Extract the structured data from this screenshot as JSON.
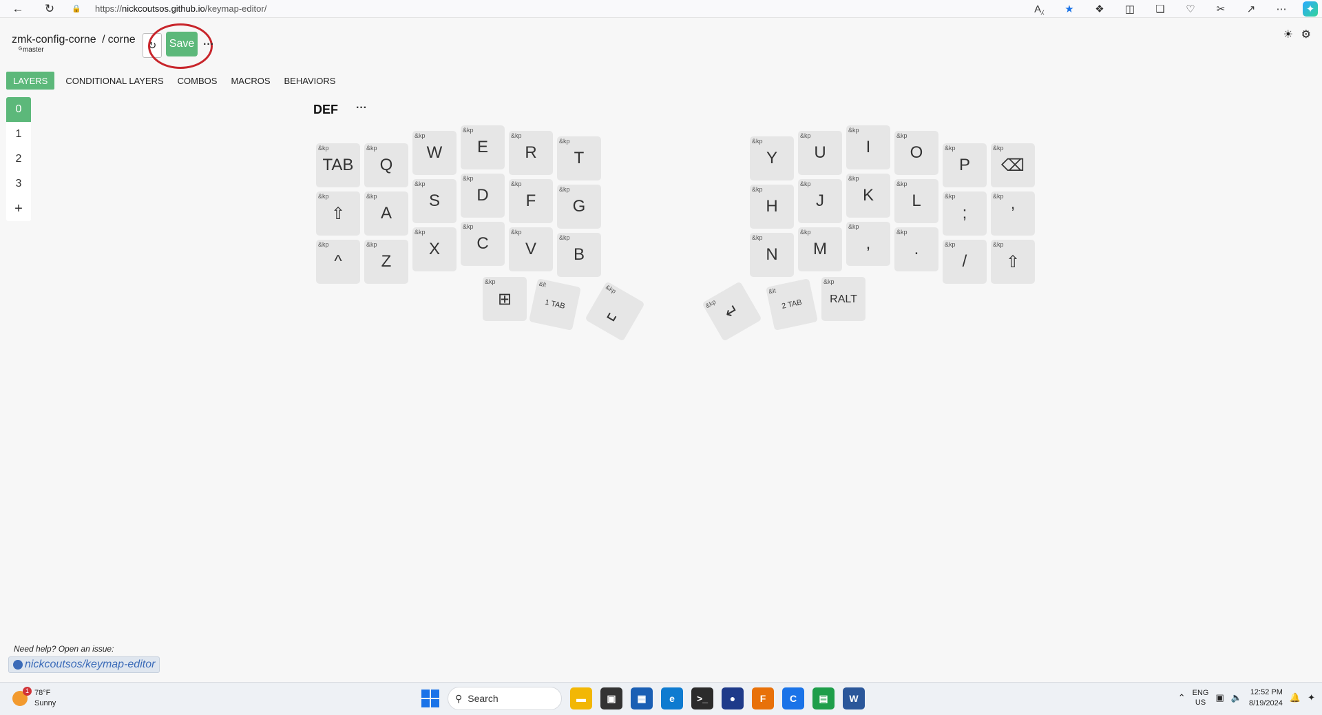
{
  "browser": {
    "url_prefix": "https://",
    "url_host": "nickcoutsos.github.io",
    "url_path": "/keymap-editor/",
    "icons": [
      "read-aloud-icon",
      "favorite-star-icon",
      "extensions-icon",
      "split-screen-icon",
      "collections-icon",
      "browser-essentials-icon",
      "screenshot-icon",
      "share-icon",
      "more-icon",
      "copilot-icon"
    ]
  },
  "header": {
    "repo": "zmk-config-corne",
    "separator": "/",
    "keyboard": "corne",
    "branch": "master",
    "save_label": "Save",
    "more_label": "···"
  },
  "tabs": [
    {
      "label": "LAYERS",
      "active": true
    },
    {
      "label": "CONDITIONAL LAYERS",
      "active": false
    },
    {
      "label": "COMBOS",
      "active": false
    },
    {
      "label": "MACROS",
      "active": false
    },
    {
      "label": "BEHAVIORS",
      "active": false
    }
  ],
  "layers": {
    "items": [
      "0",
      "1",
      "2",
      "3"
    ],
    "add_label": "+",
    "selected": "0"
  },
  "layer_view": {
    "name": "DEF",
    "more_label": "···"
  },
  "keys": [
    {
      "bind": "&kp",
      "param": "TAB"
    },
    {
      "bind": "&kp",
      "param": "Q"
    },
    {
      "bind": "&kp",
      "param": "W"
    },
    {
      "bind": "&kp",
      "param": "E"
    },
    {
      "bind": "&kp",
      "param": "R"
    },
    {
      "bind": "&kp",
      "param": "T"
    },
    {
      "bind": "&kp",
      "param": "Y"
    },
    {
      "bind": "&kp",
      "param": "U"
    },
    {
      "bind": "&kp",
      "param": "I"
    },
    {
      "bind": "&kp",
      "param": "O"
    },
    {
      "bind": "&kp",
      "param": "P"
    },
    {
      "bind": "&kp",
      "param": "⌫"
    },
    {
      "bind": "&kp",
      "param": "⇧"
    },
    {
      "bind": "&kp",
      "param": "A"
    },
    {
      "bind": "&kp",
      "param": "S"
    },
    {
      "bind": "&kp",
      "param": "D"
    },
    {
      "bind": "&kp",
      "param": "F"
    },
    {
      "bind": "&kp",
      "param": "G"
    },
    {
      "bind": "&kp",
      "param": "H"
    },
    {
      "bind": "&kp",
      "param": "J"
    },
    {
      "bind": "&kp",
      "param": "K"
    },
    {
      "bind": "&kp",
      "param": "L"
    },
    {
      "bind": "&kp",
      "param": ";"
    },
    {
      "bind": "&kp",
      "param": "’"
    },
    {
      "bind": "&kp",
      "param": "^"
    },
    {
      "bind": "&kp",
      "param": "Z"
    },
    {
      "bind": "&kp",
      "param": "X"
    },
    {
      "bind": "&kp",
      "param": "C"
    },
    {
      "bind": "&kp",
      "param": "V"
    },
    {
      "bind": "&kp",
      "param": "B"
    },
    {
      "bind": "&kp",
      "param": "N"
    },
    {
      "bind": "&kp",
      "param": "M"
    },
    {
      "bind": "&kp",
      "param": ","
    },
    {
      "bind": "&kp",
      "param": "."
    },
    {
      "bind": "&kp",
      "param": "/"
    },
    {
      "bind": "&kp",
      "param": "⇧"
    },
    {
      "bind": "&kp",
      "param": "⊞"
    },
    {
      "bind": "&lt",
      "param": "1 TAB"
    },
    {
      "bind": "&kp",
      "param": "␣"
    },
    {
      "bind": "&kp",
      "param": "↵"
    },
    {
      "bind": "&lt",
      "param": "2 TAB"
    },
    {
      "bind": "&kp",
      "param": "RALT"
    }
  ],
  "footer": {
    "help_text": "Need help? Open an issue:",
    "link_text": "nickcoutsos/keymap-editor"
  },
  "taskbar": {
    "weather_temp": "78°F",
    "weather_desc": "Sunny",
    "weather_badge": "1",
    "search_label": "Search",
    "lang_top": "ENG",
    "lang_bottom": "US",
    "time": "12:52 PM",
    "date": "8/19/2024",
    "apps": [
      {
        "name": "file-explorer",
        "color": "#f2b705",
        "glyph": "▬"
      },
      {
        "name": "task-view",
        "color": "#333333",
        "glyph": "▣"
      },
      {
        "name": "store",
        "color": "#1a5fb4",
        "glyph": "▦"
      },
      {
        "name": "edge",
        "color": "#0e7bd0",
        "glyph": "e"
      },
      {
        "name": "terminal",
        "color": "#2b2b2b",
        "glyph": ">_"
      },
      {
        "name": "media",
        "color": "#1e3a8a",
        "glyph": "●"
      },
      {
        "name": "app-f",
        "color": "#e8710a",
        "glyph": "F"
      },
      {
        "name": "app-c",
        "color": "#1a73e8",
        "glyph": "C"
      },
      {
        "name": "sheets",
        "color": "#1e9e4a",
        "glyph": "▤"
      },
      {
        "name": "word",
        "color": "#2b579a",
        "glyph": "W"
      }
    ]
  }
}
